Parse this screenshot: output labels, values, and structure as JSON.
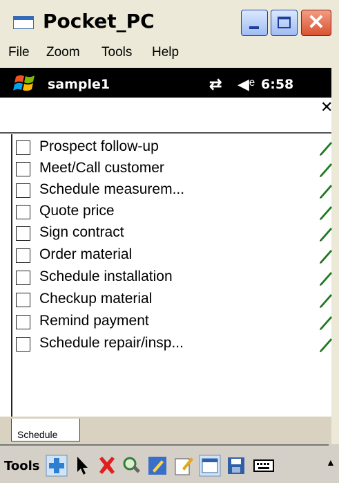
{
  "window": {
    "title": "Pocket_PC"
  },
  "menubar": {
    "items": [
      "File",
      "Zoom",
      "Tools",
      "Help"
    ]
  },
  "statusbar": {
    "app_name": "sample1",
    "time": "6:58"
  },
  "list": {
    "items": [
      {
        "label": "Prospect follow-up",
        "checked": false
      },
      {
        "label": "Meet/Call customer",
        "checked": false
      },
      {
        "label": "Schedule measurem...",
        "checked": false
      },
      {
        "label": "Quote price",
        "checked": false
      },
      {
        "label": "Sign contract",
        "checked": false
      },
      {
        "label": "Order material",
        "checked": false
      },
      {
        "label": "Schedule installation",
        "checked": false
      },
      {
        "label": "Checkup material",
        "checked": false
      },
      {
        "label": "Remind payment",
        "checked": false
      },
      {
        "label": "Schedule repair/insp...",
        "checked": false
      }
    ]
  },
  "tabs": {
    "active": "Schedule"
  },
  "toolbar": {
    "label": "Tools",
    "icons": [
      "add-icon",
      "pointer-icon",
      "delete-icon",
      "find-icon",
      "edit-icon",
      "edit-note-icon",
      "calendar-icon",
      "save-icon",
      "keyboard-icon"
    ]
  },
  "colors": {
    "accent": "#316ac5",
    "pencil": "#1e7a1e",
    "delete": "#e02020"
  }
}
